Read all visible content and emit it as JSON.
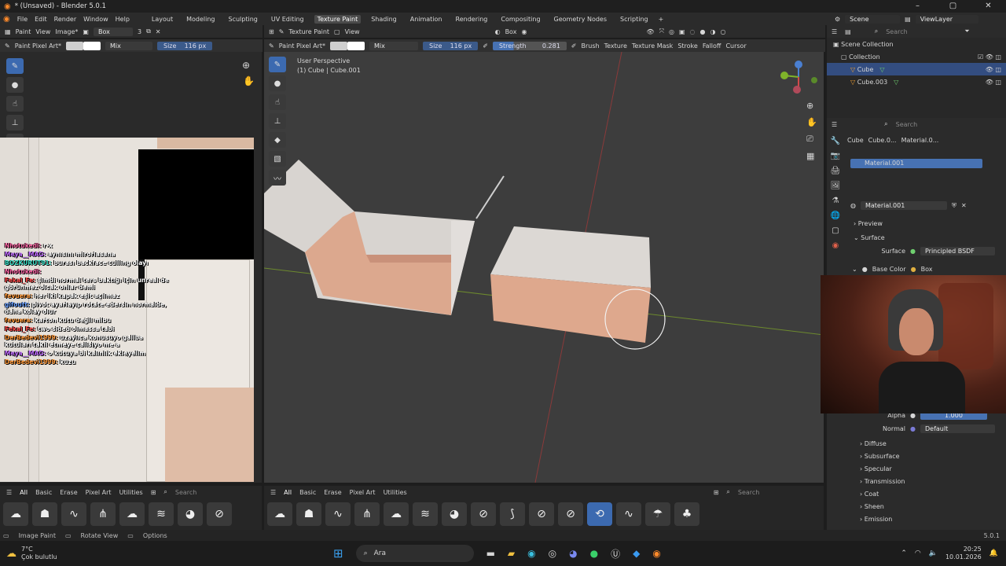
{
  "window": {
    "title": "* (Unsaved) - Blender 5.0.1",
    "controls": [
      "–",
      "▢",
      "✕"
    ]
  },
  "menubar": {
    "items": [
      "File",
      "Edit",
      "Render",
      "Window",
      "Help"
    ],
    "workspaces": [
      "Layout",
      "Modeling",
      "Sculpting",
      "UV Editing",
      "Texture Paint",
      "Shading",
      "Animation",
      "Rendering",
      "Compositing",
      "Geometry Nodes",
      "Scripting"
    ],
    "active_workspace": "Texture Paint",
    "scene": "Scene",
    "view_layer": "ViewLayer"
  },
  "image_editor": {
    "mode": "Paint",
    "view": "View",
    "image": "Image*",
    "image_name": "Box",
    "users": "3",
    "brush": "Paint Pixel Art*",
    "blend": "Mix",
    "size_label": "Size",
    "size_value": "116 px"
  },
  "viewport": {
    "mode": "Texture Paint",
    "view": "View",
    "projection": "Box",
    "brush": "Paint Pixel Art*",
    "blend": "Mix",
    "size_label": "Size",
    "size_value": "116 px",
    "strength_label": "Strength",
    "strength_value": "0.281",
    "menus": [
      "Brush",
      "Texture",
      "Texture Mask",
      "Stroke",
      "Falloff",
      "Cursor"
    ],
    "overlay_title": "User Perspective",
    "overlay_object": "(1) Cube | Cube.001"
  },
  "shelf": {
    "tabs": [
      "All",
      "Basic",
      "Erase",
      "Pixel Art",
      "Utilities"
    ],
    "search_placeholder": "Search"
  },
  "outliner": {
    "search_placeholder": "Search",
    "root": "Scene Collection",
    "collection": "Collection",
    "objects": [
      "Cube",
      "Cube.003"
    ]
  },
  "properties": {
    "search_placeholder": "Search",
    "breadcrumb": [
      "Cube",
      "Cube.0...",
      "Material.0..."
    ],
    "slot": "Material.001",
    "material_name": "Material.001",
    "panels": {
      "preview": "Preview",
      "surface": "Surface"
    },
    "surface_label": "Surface",
    "surface_value": "Principled BSDF",
    "base_color_label": "Base Color",
    "base_color_value": "Box",
    "alpha_label": "Alpha",
    "alpha_value": "1.000",
    "normal_label": "Normal",
    "normal_value": "Default",
    "subpanels": [
      "Diffuse",
      "Subsurface",
      "Specular",
      "Transmission",
      "Coat",
      "Sheen",
      "Emission"
    ]
  },
  "status": {
    "items": [
      "Image Paint",
      "Rotate View",
      "Options"
    ],
    "version": "5.0.1"
  },
  "chat": [
    {
      "user": "Nhotukedi:",
      "msg": "r-x",
      "color": "#ff6aa8"
    },
    {
      "user": "Meya__MAG:",
      "msg": "aynısını mirorlasana",
      "color": "#c06cff"
    },
    {
      "user": "BOZKURUT91:",
      "msg": "burası backface culling olayı",
      "color": "#3fe0c8"
    },
    {
      "user": "Nhotukedi:",
      "msg": "",
      "color": "#ff6aa8"
    },
    {
      "user": "Fekal_Fe:",
      "msg": "şimdi normal ters baktığı için unreal de görünmez olcak onlar demi",
      "color": "#ff4b4b"
    },
    {
      "user": "fevuera:",
      "msg": "her iki kapak eşit açılmaz",
      "color": "#ff9a3c"
    },
    {
      "user": "gifoutt:",
      "msg": "pivot ayarlayıp rotate edersin normalde, daha kolay olur",
      "color": "#6aa0ff"
    },
    {
      "user": "fevuera:",
      "msg": "karton kutu değil mibu",
      "color": "#ff9a3c"
    },
    {
      "user": "Fekal_Fe:",
      "msg": "two sided olmassa tabi",
      "color": "#ff4b4b"
    },
    {
      "user": "DerBedevi1999:",
      "msg": "uzaylıca konusuyo galiba kutuları takıl etmeye calisiyo me a",
      "color": "#ff9a3c"
    },
    {
      "user": "Meya__MAG:",
      "msg": "o kutuya bi kalınlık ekleyelim",
      "color": "#c06cff"
    },
    {
      "user": "DerBedevi1999:",
      "msg": "kuzu",
      "color": "#ff9a3c"
    }
  ],
  "taskbar": {
    "weather_temp": "7°C",
    "weather_desc": "Çok bulutlu",
    "search": "Ara",
    "time": "20:25",
    "date": "10.01.2026"
  }
}
